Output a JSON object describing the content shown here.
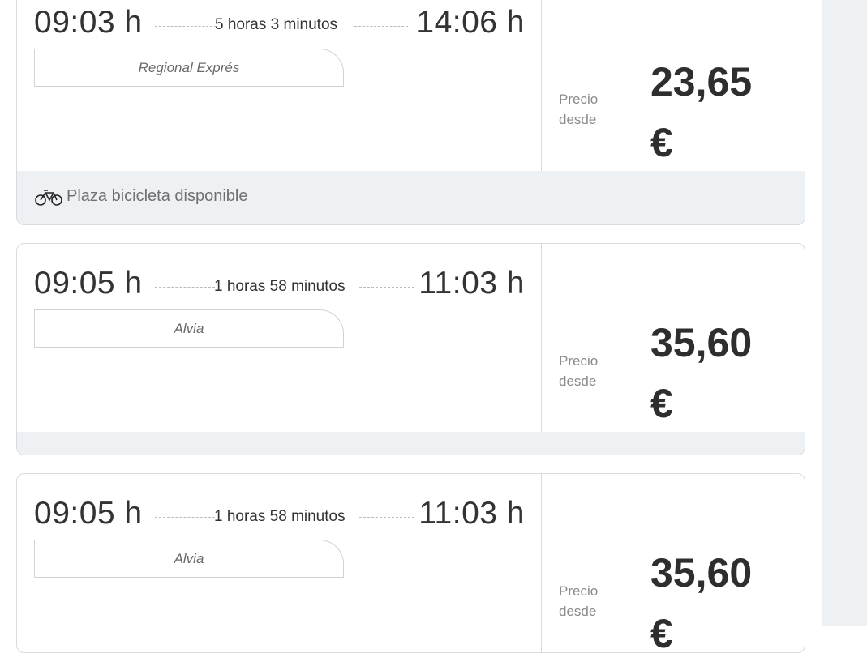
{
  "results": [
    {
      "departure": "09:03 h",
      "duration": "5 horas 3 minutos",
      "arrival": "14:06 h",
      "train_type": "Regional Exprés",
      "price_label_line1": "Precio",
      "price_label_line2": "desde",
      "price_amount": "23,65",
      "price_currency": "€",
      "footer_text": "Plaza bicicleta disponible"
    },
    {
      "departure": "09:05 h",
      "duration": "1 horas 58 minutos",
      "arrival": "11:03 h",
      "train_type": "Alvia",
      "price_label_line1": "Precio",
      "price_label_line2": "desde",
      "price_amount": "35,60",
      "price_currency": "€"
    },
    {
      "departure": "09:05 h",
      "duration": "1 horas 58 minutos",
      "arrival": "11:03 h",
      "train_type": "Alvia",
      "price_label_line1": "Precio",
      "price_label_line2": "desde",
      "price_amount": "35,60",
      "price_currency": "€"
    }
  ],
  "icons": {
    "footer_icon": "bicycle-icon"
  }
}
